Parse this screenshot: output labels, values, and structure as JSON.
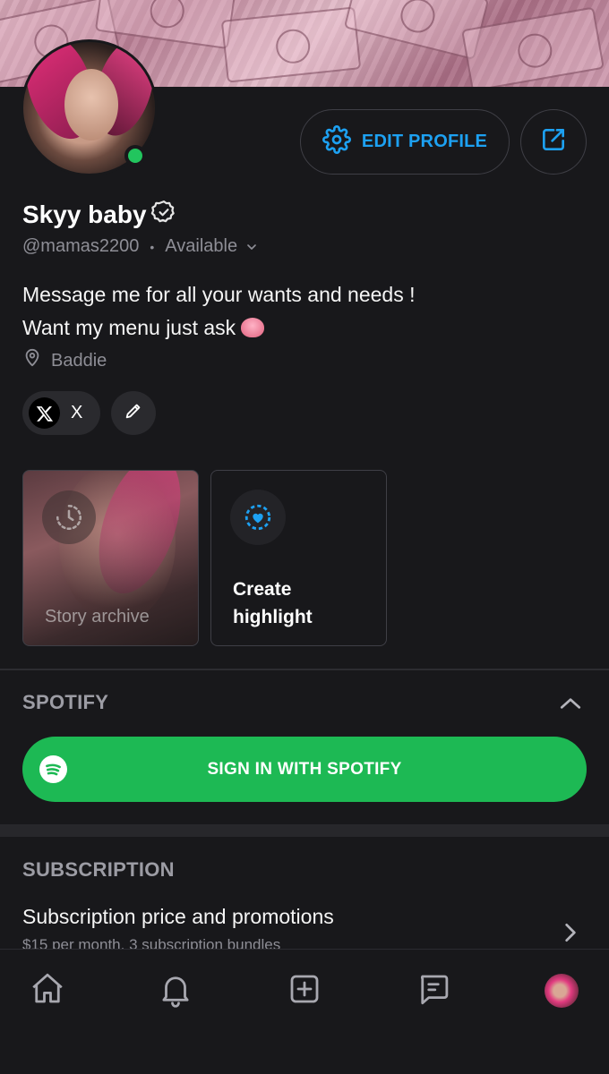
{
  "profile": {
    "name": "Skyy baby",
    "handle": "@mamas2200",
    "status": "Available",
    "bio_line1": "Message me for all your wants and needs !",
    "bio_line2": "Want my menu just ask",
    "location": "Baddie",
    "online_color": "#22c55e"
  },
  "header": {
    "edit_profile_label": "EDIT PROFILE",
    "share_icon": "share-icon",
    "settings_icon": "gear-icon"
  },
  "social": {
    "x_label": "X",
    "x_icon": "x-logo-icon",
    "edit_icon": "pencil-icon"
  },
  "highlights": {
    "archive_label": "Story archive",
    "create_label_line1": "Create",
    "create_label_line2": "highlight"
  },
  "spotify": {
    "section_title": "SPOTIFY",
    "sign_in_label": "SIGN IN WITH SPOTIFY",
    "brand_color": "#1db954"
  },
  "subscription": {
    "section_title": "SUBSCRIPTION",
    "row_title": "Subscription price and promotions",
    "row_subtitle": "$15 per month, 3 subscription bundles"
  },
  "nav": {
    "items": [
      "home-icon",
      "bell-icon",
      "add-post-icon",
      "messages-icon",
      "profile-avatar"
    ]
  },
  "colors": {
    "accent": "#1da1f2",
    "background": "#18181b"
  }
}
